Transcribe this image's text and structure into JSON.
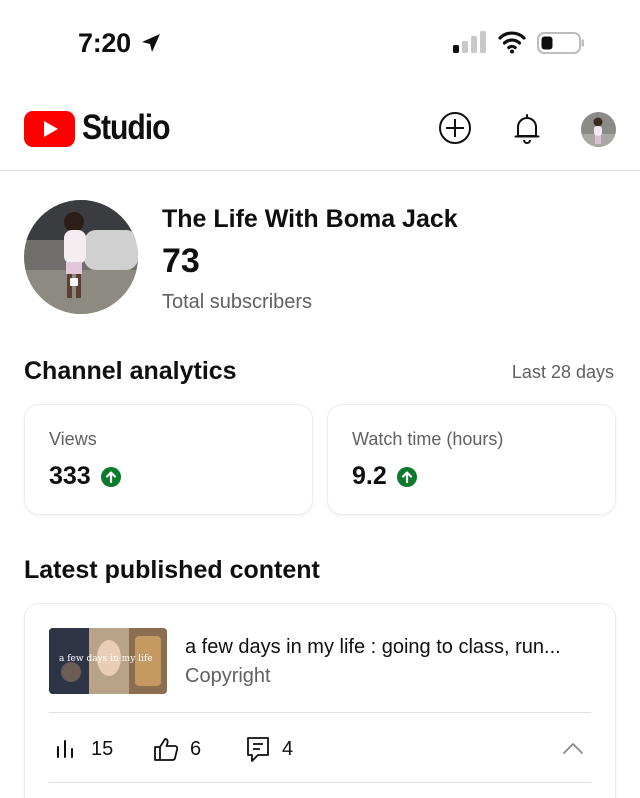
{
  "status_bar": {
    "time": "7:20",
    "icons": [
      "location-arrow-icon",
      "cellular-signal-icon",
      "wifi-icon",
      "battery-icon"
    ]
  },
  "header": {
    "logo_text": "Studio",
    "icons": [
      "youtube-logo-icon",
      "create-plus-icon",
      "notifications-bell-icon",
      "profile-avatar"
    ]
  },
  "channel": {
    "name": "The Life With Boma Jack",
    "subscriber_count": "73",
    "subscriber_label": "Total subscribers"
  },
  "analytics": {
    "title": "Channel analytics",
    "period": "Last 28 days",
    "cards": [
      {
        "label": "Views",
        "value": "333",
        "trend": "up"
      },
      {
        "label": "Watch time (hours)",
        "value": "9.2",
        "trend": "up"
      }
    ]
  },
  "latest": {
    "title": "Latest published content",
    "video": {
      "title": "a few days in my life : going to class, run...",
      "status": "Copyright",
      "thumbnail_caption": "a few days in my life",
      "stats": {
        "views": "15",
        "likes": "6",
        "comments": "4"
      }
    }
  },
  "colors": {
    "brand_red": "#ff0000",
    "trend_green": "#0b7a2b",
    "secondary_text": "#606060"
  }
}
